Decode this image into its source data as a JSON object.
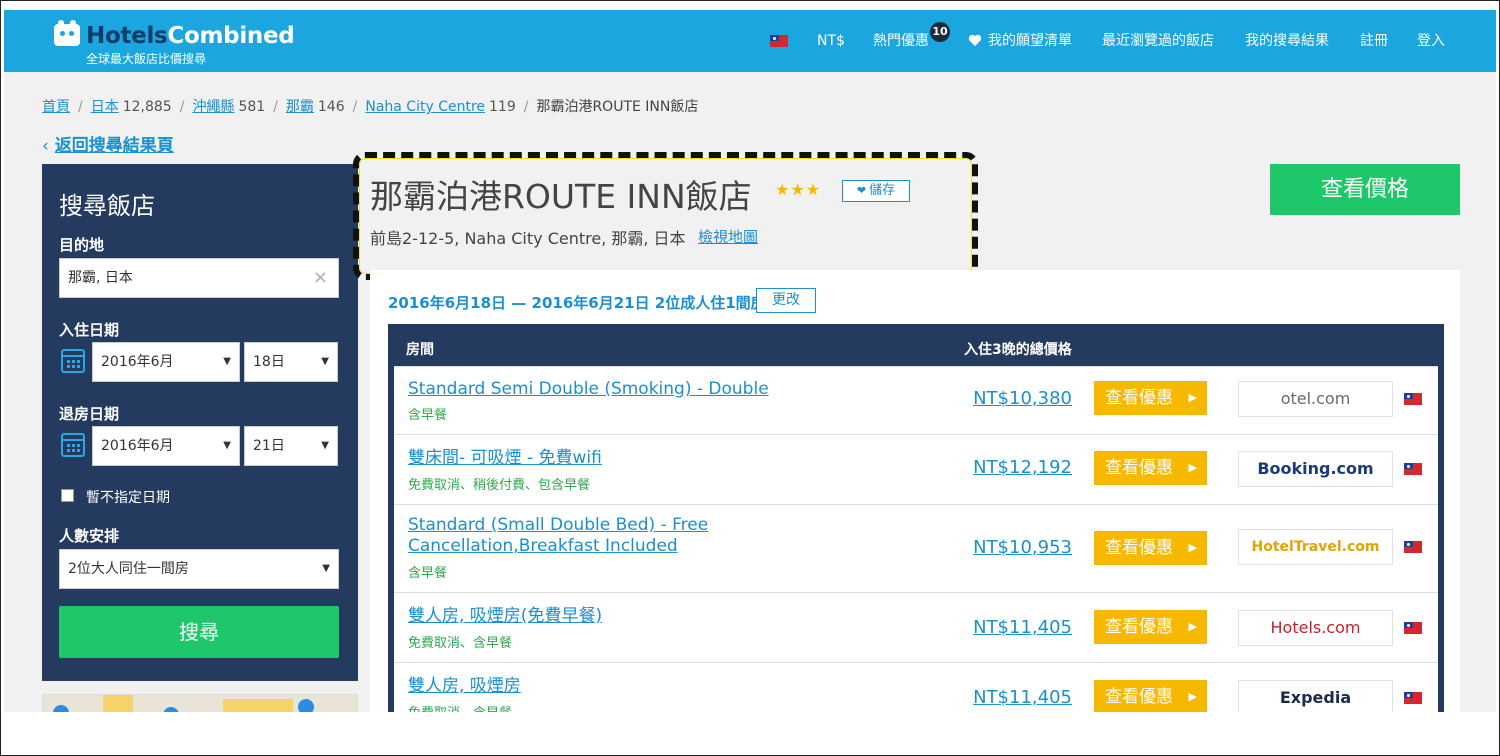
{
  "header": {
    "logo_part1": "Hotels",
    "logo_part2": "Combined",
    "tagline": "全球最大飯店比價搜尋",
    "currency": "NT$",
    "hot_deals": "熱門優惠",
    "hot_deals_count": "10",
    "wishlist": "我的願望清單",
    "recent": "最近瀏覽過的飯店",
    "my_searches": "我的搜尋結果",
    "register": "註冊",
    "login": "登入",
    "flag_icon": "taiwan-flag-icon",
    "accent_color": "#1ba6e0"
  },
  "breadcrumb": [
    {
      "label": "首頁",
      "count": ""
    },
    {
      "label": "日本",
      "count": "12,885"
    },
    {
      "label": "沖繩縣",
      "count": "581"
    },
    {
      "label": "那霸",
      "count": "146"
    },
    {
      "label": "Naha City Centre",
      "count": "119"
    }
  ],
  "breadcrumb_current": "那霸泊港ROUTE INN飯店",
  "back_link": "返回搜尋結果頁",
  "back_icon": "chevron-left-icon",
  "sidebar": {
    "title": "搜尋飯店",
    "destination_label": "目的地",
    "destination_value": "那霸, 日本",
    "clear_icon": "×",
    "checkin_label": "入住日期",
    "checkin_month": "2016年6月",
    "checkin_day": "18日",
    "checkout_label": "退房日期",
    "checkout_month": "2016年6月",
    "checkout_day": "21日",
    "no_dates_label": "暫不指定日期",
    "guests_label": "人數安排",
    "guests_value": "2位大人同住一間房",
    "search_button": "搜尋"
  },
  "hotel": {
    "name": "那霸泊港ROUTE INN飯店",
    "stars": "★★★",
    "save": "儲存",
    "address": "前島2-12-5, Naha City Centre, 那霸, 日本",
    "view_map": "檢視地圖",
    "view_prices": "查看價格"
  },
  "booking": {
    "dates": "2016年6月18日 — 2016年6月21日 2位成人住1間房",
    "change": "更改"
  },
  "table": {
    "col_room": "房間",
    "col_total": "入住3晚的總價格",
    "deal_label": "查看優惠",
    "rows": [
      {
        "name": "Standard Semi Double (Smoking) - Double",
        "sub": "含早餐",
        "price": "NT$10,380",
        "provider": "otel.com"
      },
      {
        "name": "雙床間- 可吸煙 - 免費wifi",
        "sub": "免費取消、稍後付費、包含早餐",
        "price": "NT$12,192",
        "provider": "Booking.com"
      },
      {
        "name": "Standard (Small Double Bed) - Free Cancellation,Breakfast Included",
        "sub": "含早餐",
        "price": "NT$10,953",
        "provider": "HotelTravel.com"
      },
      {
        "name": "雙人房, 吸煙房(免費早餐)",
        "sub": "免費取消、含早餐",
        "price": "NT$11,405",
        "provider": "Hotels.com"
      },
      {
        "name": "雙人房, 吸煙房",
        "sub": "免費取消、含早餐",
        "price": "NT$11,405",
        "provider": "Expedia"
      }
    ]
  },
  "colors": {
    "navy": "#243a5e",
    "green": "#1ec86a",
    "deal_yellow": "#f7b900",
    "link_blue": "#1b8fd0"
  }
}
